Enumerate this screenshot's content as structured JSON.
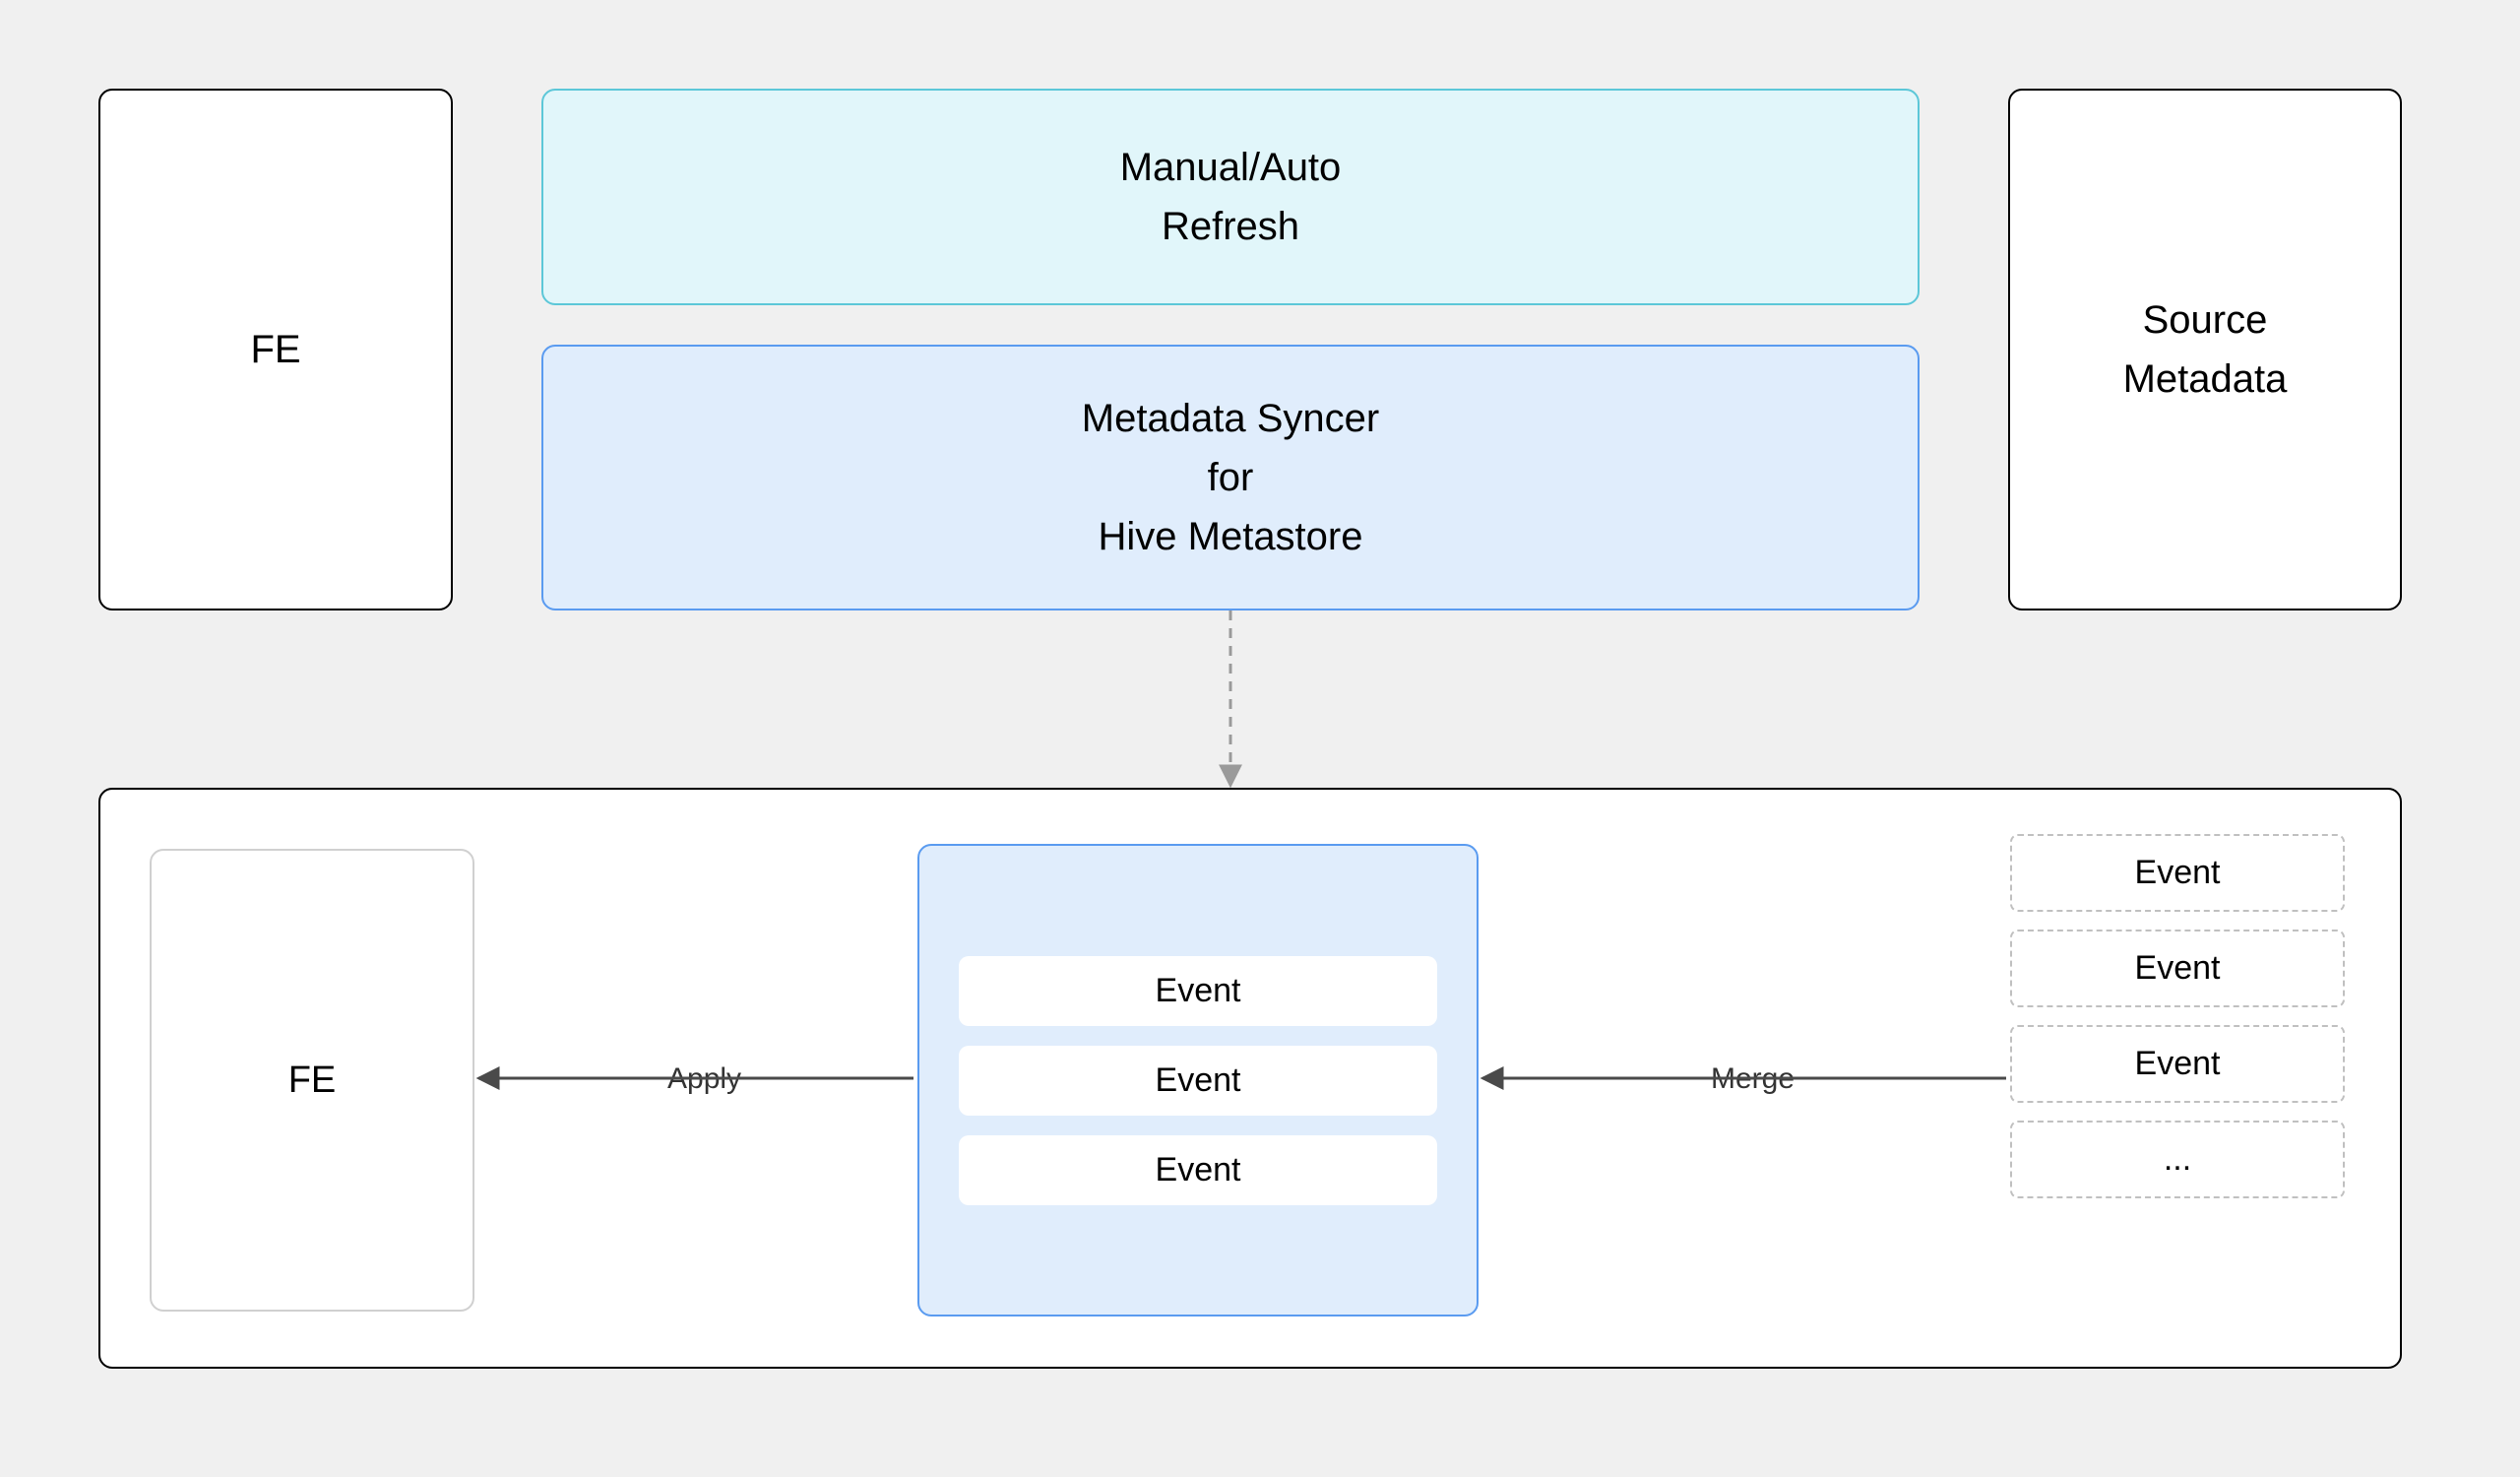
{
  "top": {
    "fe_label": "FE",
    "refresh_line1": "Manual/Auto",
    "refresh_line2": "Refresh",
    "syncer_line1": "Metadata Syncer",
    "syncer_line2": "for",
    "syncer_line3": "Hive Metastore",
    "source_line1": "Source",
    "source_line2": "Metadata"
  },
  "bottom": {
    "fe_label": "FE",
    "apply_label": "Apply",
    "merge_label": "Merge",
    "event_chips": [
      "Event",
      "Event",
      "Event"
    ],
    "dashed_chips": [
      "Event",
      "Event",
      "Event",
      "..."
    ]
  }
}
